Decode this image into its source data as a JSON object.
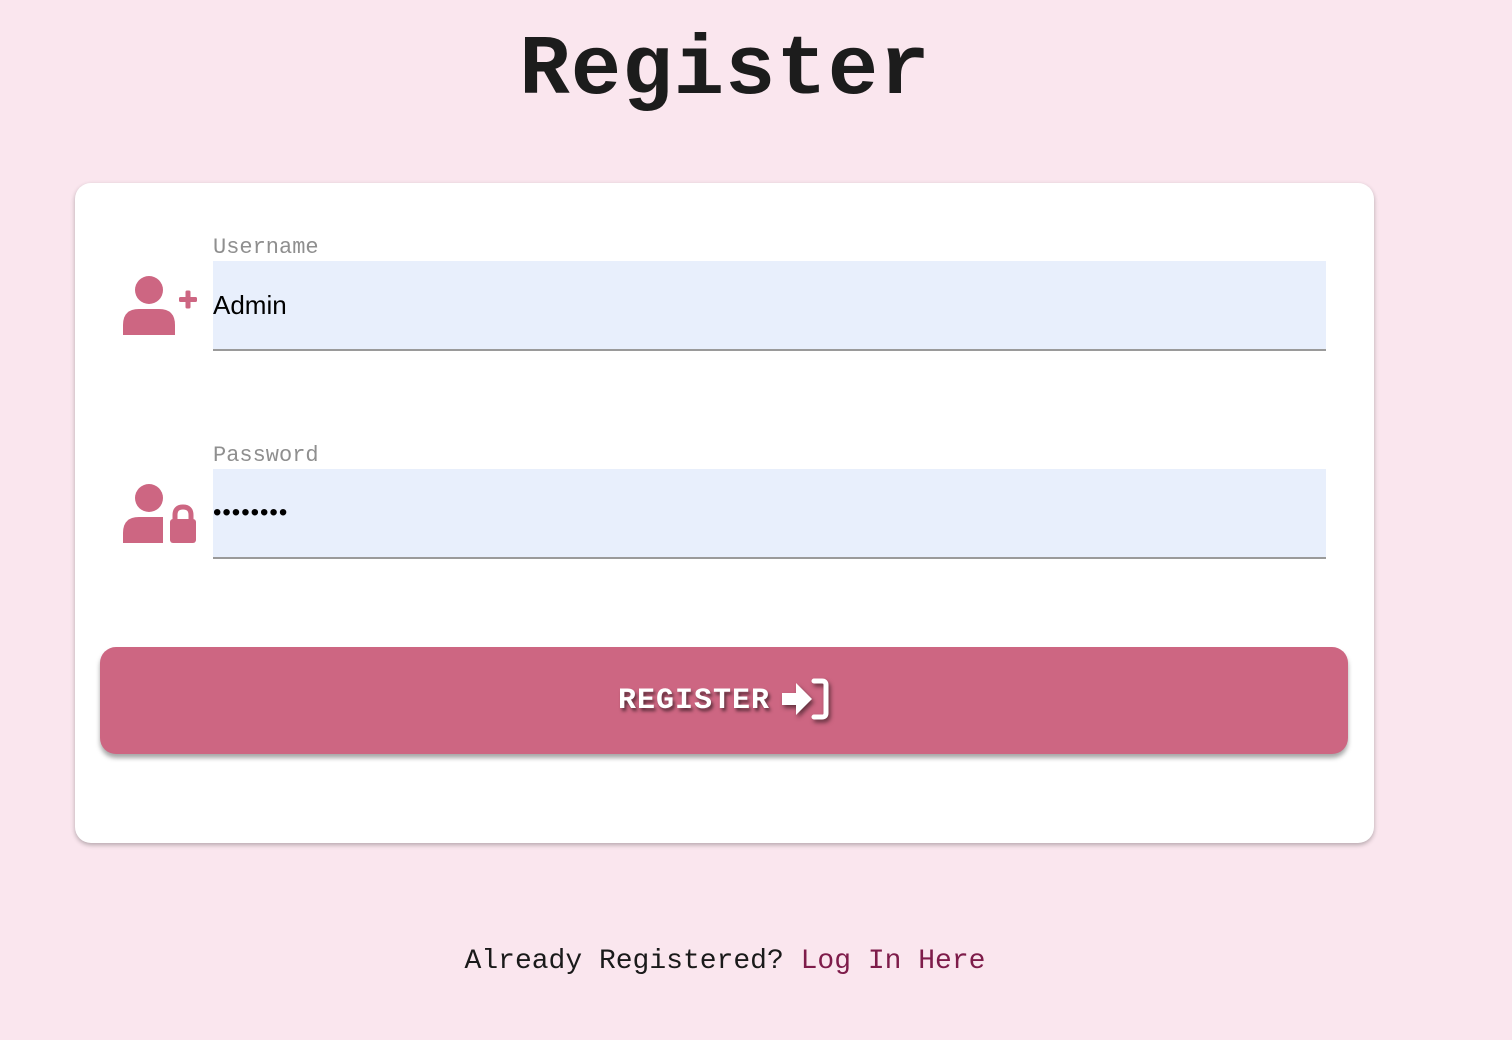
{
  "page": {
    "title": "Register"
  },
  "form": {
    "username": {
      "label": "Username",
      "value": "Admin",
      "icon": "user-plus-icon"
    },
    "password": {
      "label": "Password",
      "value": "12345678",
      "icon": "user-lock-icon"
    },
    "submit": {
      "label": "REGISTER",
      "icon": "sign-in-icon"
    }
  },
  "footer": {
    "prompt": "Already Registered?",
    "link_label": "Log In Here"
  },
  "colors": {
    "background": "#fae6ee",
    "accent": "#cd6682",
    "input_fill": "#e8effc",
    "link": "#7e1c4a"
  }
}
